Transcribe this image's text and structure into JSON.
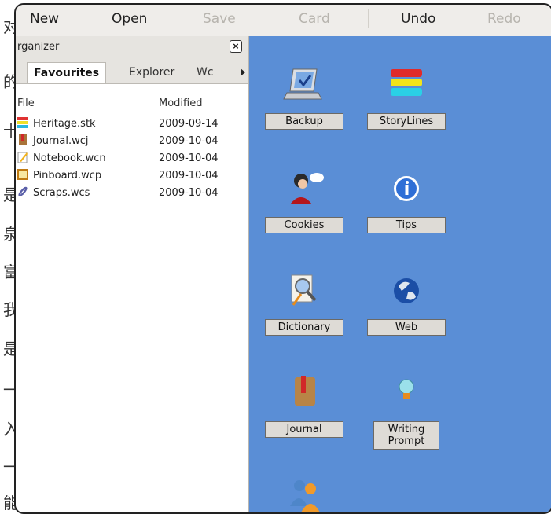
{
  "margin_text": [
    "对",
    "的",
    "十",
    "是",
    "泉",
    "富",
    "我",
    "是",
    "一",
    "入",
    "一",
    "能"
  ],
  "toolbar": {
    "new_label": "New",
    "open_label": "Open",
    "save_label": "Save",
    "card_label": "Card",
    "undo_label": "Undo",
    "redo_label": "Redo"
  },
  "organizer": {
    "title": "rganizer",
    "close_glyph": "×",
    "tabs": [
      "Favourites",
      "Explorer",
      "Wc"
    ],
    "columns": {
      "file": "File",
      "modified": "Modified"
    },
    "files": [
      {
        "name": "Heritage.stk",
        "modified": "2009-09-14",
        "icon": "storylines-icon"
      },
      {
        "name": "Journal.wcj",
        "modified": "2009-10-04",
        "icon": "journal-icon"
      },
      {
        "name": "Notebook.wcn",
        "modified": "2009-10-04",
        "icon": "notebook-icon"
      },
      {
        "name": "Pinboard.wcp",
        "modified": "2009-10-04",
        "icon": "pinboard-icon"
      },
      {
        "name": "Scraps.wcs",
        "modified": "2009-10-04",
        "icon": "scraps-icon"
      }
    ]
  },
  "launchers": [
    {
      "label": "Backup",
      "icon": "laptop-backup-icon"
    },
    {
      "label": "StoryLines",
      "icon": "storylines-icon"
    },
    {
      "label": "Cookies",
      "icon": "cookies-person-icon"
    },
    {
      "label": "Tips",
      "icon": "info-icon"
    },
    {
      "label": "Dictionary",
      "icon": "dictionary-icon"
    },
    {
      "label": "Web",
      "icon": "globe-icon"
    },
    {
      "label": "Journal",
      "icon": "journal-icon"
    },
    {
      "label": "Writing Prompt",
      "icon": "lightbulb-icon"
    },
    {
      "label": "",
      "icon": "people-icon"
    }
  ],
  "colors": {
    "desktop": "#5a8ed6",
    "toolbar": "#efedea"
  }
}
